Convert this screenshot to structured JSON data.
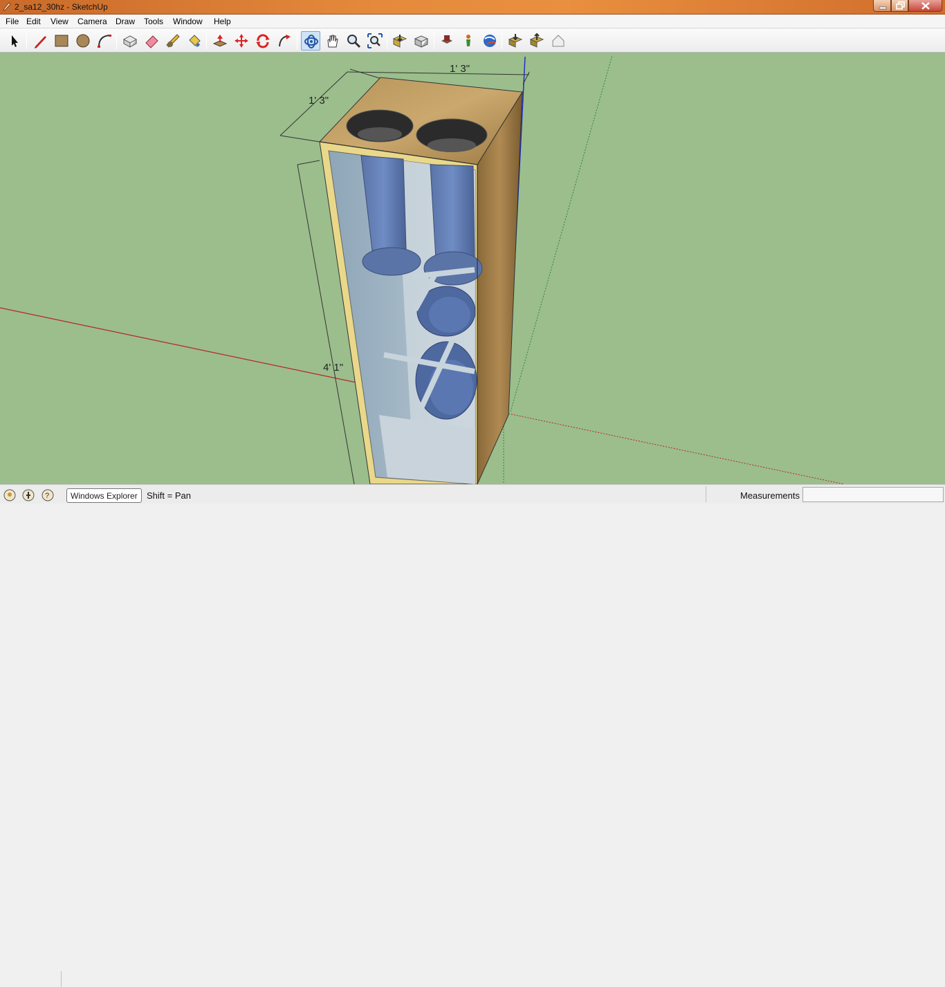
{
  "window": {
    "title": "2_sa12_30hz - SketchUp"
  },
  "menu": {
    "items": [
      "File",
      "Edit",
      "View",
      "Camera",
      "Draw",
      "Tools",
      "Window",
      "Help"
    ]
  },
  "toolbar": {
    "tools": [
      "select-tool",
      "pencil-tool",
      "rectangle-tool",
      "circle-tool",
      "arc-tool",
      "make-component-tool",
      "eraser-tool",
      "tape-measure-tool",
      "paint-bucket-tool",
      "push-pull-tool",
      "move-tool",
      "rotate-tool",
      "follow-me-tool",
      "orbit-tool",
      "pan-tool",
      "zoom-tool",
      "zoom-extents-tool",
      "get-models-tool",
      "share-model-tool",
      "share-component-tool",
      "section-plane-tool",
      "add-location-tool",
      "toggle-terrain-tool",
      "photo-textures-tool",
      "preview-in-google-earth-tool",
      "get-current-view-tool"
    ],
    "active_tool": "orbit-tool"
  },
  "viewport": {
    "background": "#9bbe8c",
    "dimensions": {
      "width": "1' 3\"",
      "depth": "1' 3\"",
      "height": "4' 1\""
    }
  },
  "statusbar": {
    "tooltip": "Windows Explorer",
    "status": "Shift = Pan",
    "measurements_label": "Measurements",
    "measurements_value": ""
  }
}
